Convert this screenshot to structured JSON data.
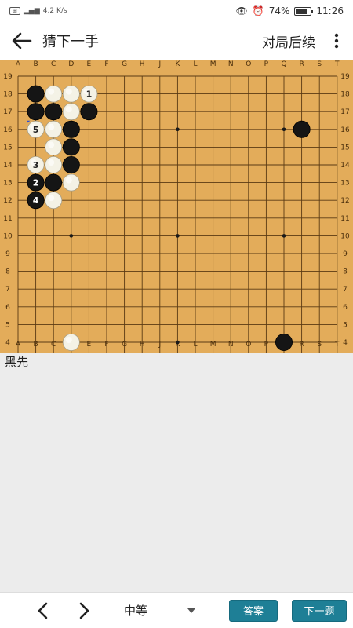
{
  "status_bar": {
    "signal_text": "4.2 K/s",
    "battery": "74%",
    "battery_level": 0.74,
    "time": "11:26"
  },
  "header": {
    "title": "猜下一手",
    "continue_label": "对局后续"
  },
  "board": {
    "size": 19,
    "columns": [
      "A",
      "B",
      "C",
      "D",
      "E",
      "F",
      "G",
      "H",
      "J",
      "K",
      "L",
      "M",
      "N",
      "O",
      "P",
      "Q",
      "R",
      "S",
      "T"
    ],
    "rows": [
      "19",
      "18",
      "17",
      "16",
      "15",
      "14",
      "13",
      "12",
      "11",
      "10",
      "9",
      "8",
      "7",
      "6",
      "5",
      "4",
      "3",
      "2",
      "1"
    ],
    "star_points": [
      "D16",
      "K16",
      "Q16",
      "D10",
      "K10",
      "Q10",
      "D4",
      "K4",
      "Q4"
    ],
    "stones": [
      {
        "point": "B18",
        "color": "black"
      },
      {
        "point": "B17",
        "color": "black"
      },
      {
        "point": "C17",
        "color": "black"
      },
      {
        "point": "D16",
        "color": "black"
      },
      {
        "point": "D15",
        "color": "black"
      },
      {
        "point": "D14",
        "color": "black"
      },
      {
        "point": "C13",
        "color": "black"
      },
      {
        "point": "E17",
        "color": "black"
      },
      {
        "point": "R16",
        "color": "black"
      },
      {
        "point": "Q4",
        "color": "black"
      },
      {
        "point": "B13",
        "color": "black",
        "label": "2"
      },
      {
        "point": "B12",
        "color": "black",
        "label": "4"
      },
      {
        "point": "C18",
        "color": "white"
      },
      {
        "point": "D18",
        "color": "white"
      },
      {
        "point": "D17",
        "color": "white"
      },
      {
        "point": "C16",
        "color": "white"
      },
      {
        "point": "C15",
        "color": "white"
      },
      {
        "point": "C14",
        "color": "white"
      },
      {
        "point": "D13",
        "color": "white"
      },
      {
        "point": "C12",
        "color": "white"
      },
      {
        "point": "D4",
        "color": "white"
      },
      {
        "point": "E18",
        "color": "white",
        "label": "1"
      },
      {
        "point": "B16",
        "color": "white",
        "label": "5",
        "last_move": true
      },
      {
        "point": "B14",
        "color": "white",
        "label": "3"
      }
    ]
  },
  "prompt": "黑先",
  "footer": {
    "level": "中等",
    "answer_label": "答案",
    "next_question_label": "下一题"
  }
}
